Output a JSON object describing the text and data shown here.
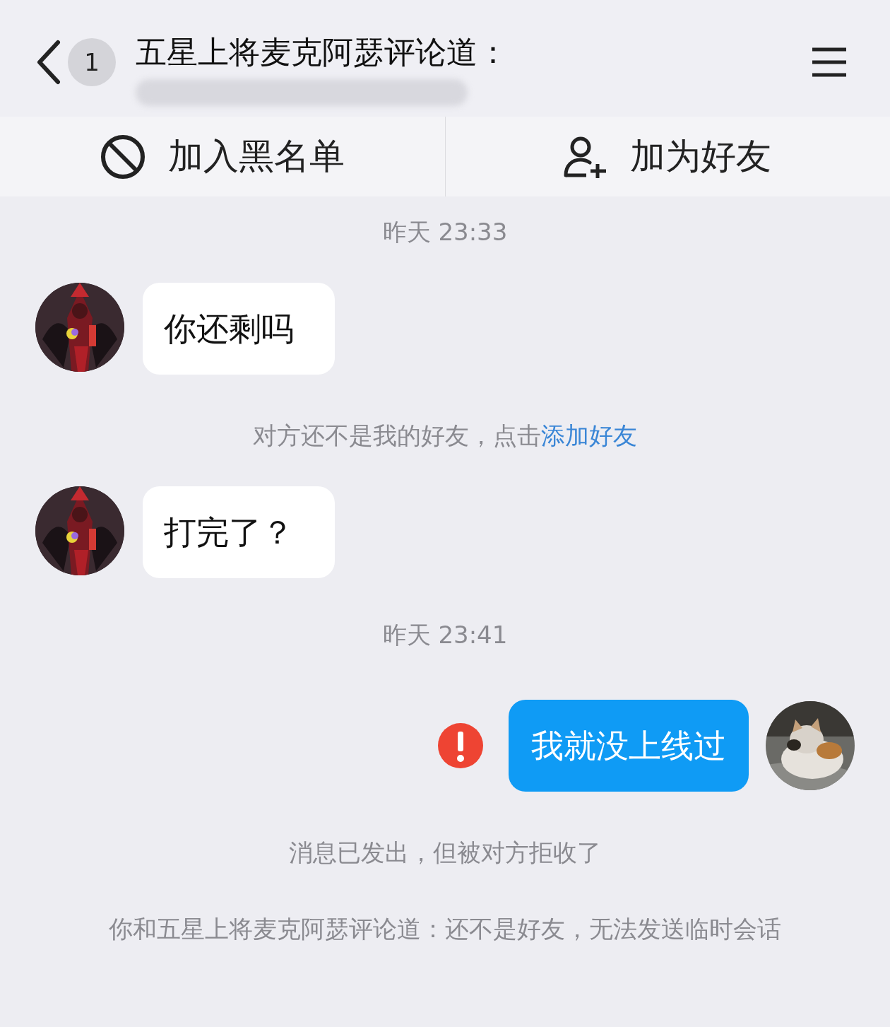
{
  "header": {
    "back_badge": "1",
    "title": "五星上将麦克阿瑟评论道："
  },
  "actions": [
    {
      "label": "加入黑名单",
      "kind": "block"
    },
    {
      "label": "加为好友",
      "kind": "add-friend"
    }
  ],
  "messages": [
    {
      "kind": "time",
      "text": "昨天 23:33"
    },
    {
      "kind": "incoming",
      "text": "你还剩吗"
    },
    {
      "kind": "notice",
      "text": "对方还不是我的好友，点击",
      "link": "添加好友"
    },
    {
      "kind": "incoming",
      "text": "打完了？"
    },
    {
      "kind": "time",
      "text": "昨天 23:41"
    },
    {
      "kind": "outgoing",
      "text": "我就没上线过",
      "failed": true
    },
    {
      "kind": "notice",
      "text": "消息已发出，但被对方拒收了"
    },
    {
      "kind": "notice",
      "text": "你和五星上将麦克阿瑟评论道：还不是好友，无法发送临时会话"
    }
  ]
}
